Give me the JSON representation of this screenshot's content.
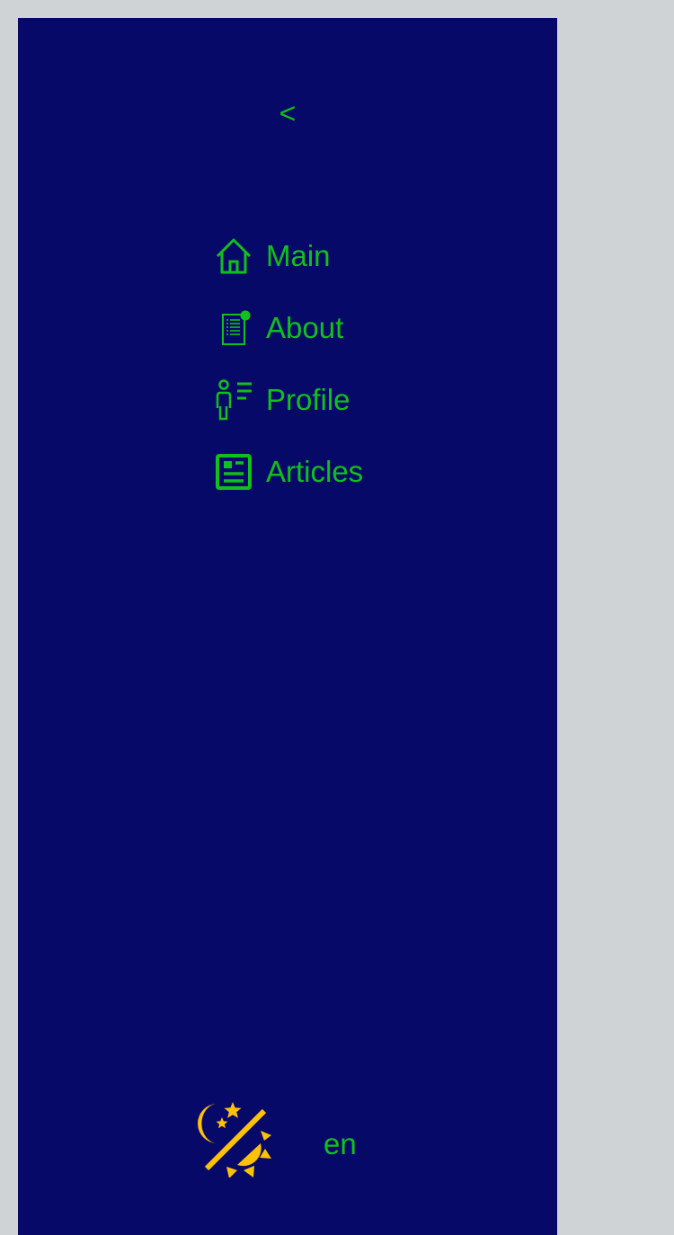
{
  "sidebar": {
    "collapse_label": "<",
    "items": [
      {
        "label": "Main",
        "icon": "home-icon"
      },
      {
        "label": "About",
        "icon": "document-icon"
      },
      {
        "label": "Profile",
        "icon": "profile-icon"
      },
      {
        "label": "Articles",
        "icon": "articles-icon"
      }
    ],
    "theme_toggle_icon": "theme-toggle-icon",
    "language": "en"
  },
  "colors": {
    "sidebar_bg": "#070969",
    "page_bg": "#cfd3d6",
    "accent": "#11c01b",
    "theme_icon": "#ffc107"
  }
}
